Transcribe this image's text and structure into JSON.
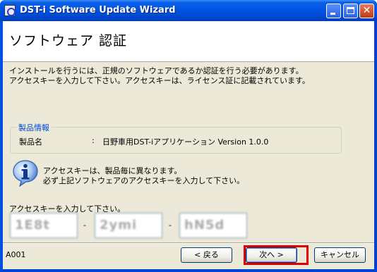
{
  "window": {
    "title": "DST-i Software Update Wizard"
  },
  "header": {
    "title": "ソフトウェア 認証"
  },
  "instructions": {
    "line1": "インストールを行うには、正規のソフトウェアであるか認証を行う必要があります。",
    "line2": "アクセスキーを入力して下さい。アクセスキーは、ライセンス証に記載されています。"
  },
  "product_info": {
    "legend": "製品情報",
    "label": "製品名",
    "colon": ":",
    "value": "日野車用DST-iアプリケーション Version 1.0.0"
  },
  "info": {
    "line1": "アクセスキーは、製品毎に異なります。",
    "line2": "必ず上記ソフトウェアのアクセスキーを入力して下さい。"
  },
  "access_key": {
    "label": "アクセスキーを入力して下さい。",
    "separator": "-",
    "fields": [
      "1E8t",
      "2ymi",
      "hN5d"
    ]
  },
  "footer": {
    "page_code": "A001",
    "back_label": "< 戻る",
    "next_label": "次へ >",
    "cancel_label": "キャンセル"
  },
  "colors": {
    "titlebar": "#0054e3",
    "client_bg": "#ece9d8",
    "legend_text": "#0046d5",
    "highlight": "#e00000"
  }
}
